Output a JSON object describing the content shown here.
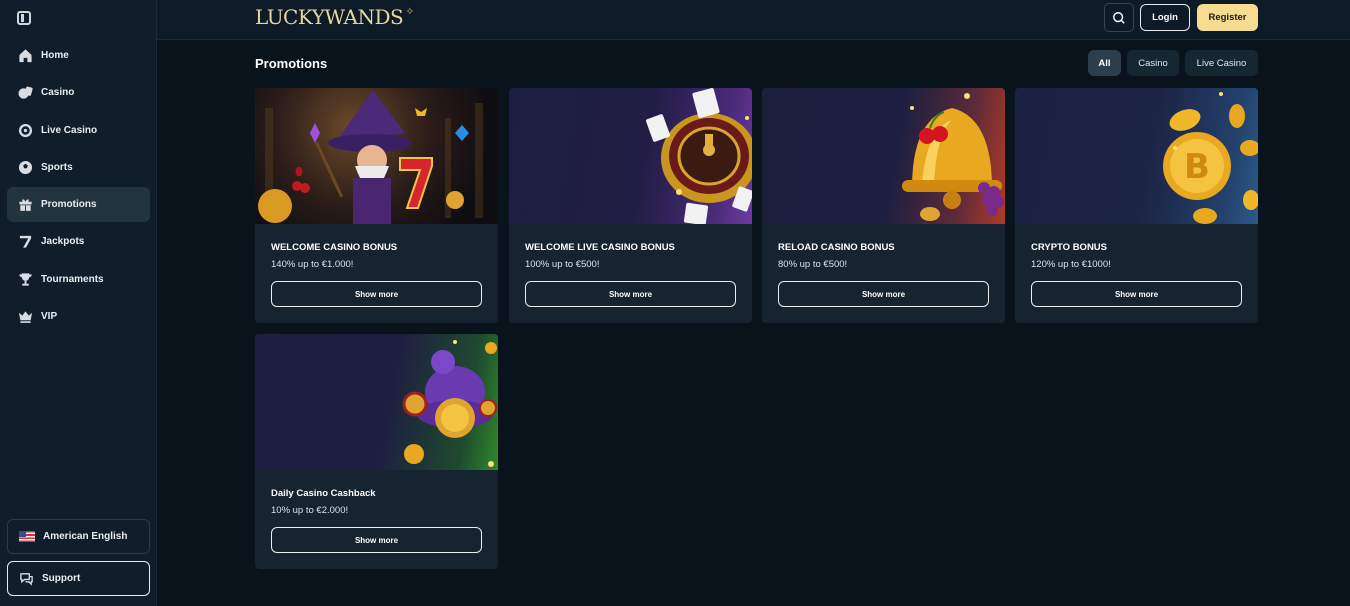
{
  "brand": {
    "logo_text": "LUCKYWANDS",
    "logo_star": "✧"
  },
  "sidebar": {
    "items": [
      {
        "label": "Home",
        "icon": "home-icon"
      },
      {
        "label": "Casino",
        "icon": "casino-chip-icon"
      },
      {
        "label": "Live Casino",
        "icon": "roulette-icon"
      },
      {
        "label": "Sports",
        "icon": "soccer-ball-icon"
      },
      {
        "label": "Promotions",
        "icon": "gift-icon",
        "active": true
      },
      {
        "label": "Jackpots",
        "icon": "seven-icon"
      },
      {
        "label": "Tournaments",
        "icon": "trophy-icon"
      },
      {
        "label": "VIP",
        "icon": "crown-icon"
      }
    ],
    "language": "American English",
    "support": "Support"
  },
  "header": {
    "login": "Login",
    "register": "Register"
  },
  "page": {
    "title": "Promotions",
    "filters": [
      "All",
      "Casino",
      "Live Casino"
    ],
    "active_filter": "All"
  },
  "promotions": [
    {
      "title": "WELCOME CASINO BONUS",
      "subtitle": "140% up to €1.000!",
      "button": "Show more"
    },
    {
      "title": "WELCOME LIVE CASINO BONUS",
      "subtitle": "100% up to €500!",
      "button": "Show more"
    },
    {
      "title": "RELOAD CASINO BONUS",
      "subtitle": "80% up to €500!",
      "button": "Show more"
    },
    {
      "title": "CRYPTO BONUS",
      "subtitle": "120% up to €1000!",
      "button": "Show more"
    },
    {
      "title": "Daily Casino Cashback",
      "subtitle": "10% up to €2.000!",
      "button": "Show more"
    }
  ],
  "colors": {
    "accent": "#f5dc90",
    "background": "#08131c",
    "sidebar": "#0f1e2a",
    "card": "#162330"
  }
}
